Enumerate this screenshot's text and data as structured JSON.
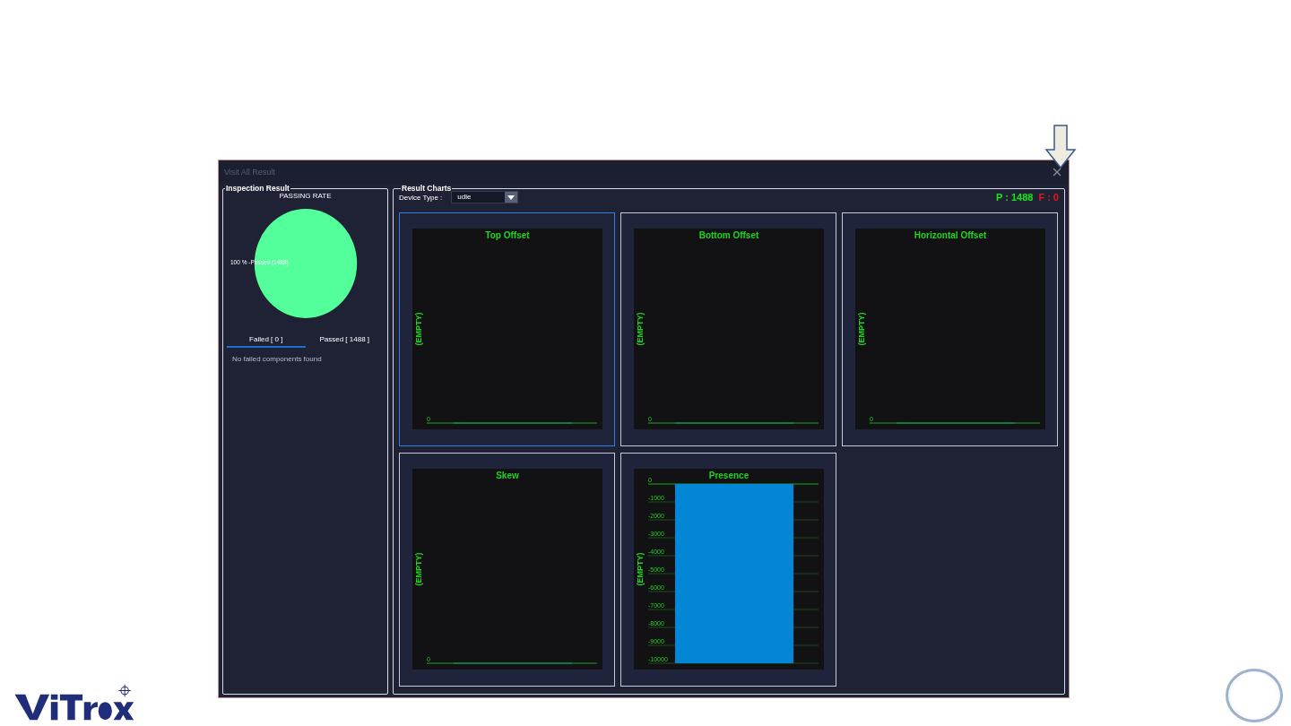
{
  "window": {
    "title": "Visit All Result"
  },
  "inspection_result": {
    "legend": "Inspection Result",
    "chart_data": {
      "type": "pie",
      "title": "PASSING RATE",
      "values": [
        1488
      ],
      "value_labels": [
        "100 % -Passed (1488)"
      ]
    },
    "tabs": [
      {
        "label": "Failed [ 0 ]",
        "selected": true
      },
      {
        "label": "Passed [ 1488 ]",
        "selected": false
      }
    ],
    "message": "No failed components found"
  },
  "result_charts": {
    "legend": "Result Charts",
    "device_type_label": "Device Type :",
    "device_type": "udie",
    "passed": "P : 1488",
    "failed": "F : 0",
    "charts": [
      {
        "kind": "empty",
        "selected": true,
        "title": "Top Offset",
        "ylabel": "(EMPTY)",
        "tick": "0"
      },
      {
        "kind": "empty",
        "selected": false,
        "title": "Bottom Offset",
        "ylabel": "(EMPTY)",
        "tick": "0"
      },
      {
        "kind": "empty",
        "selected": false,
        "title": "Horizontal Offset",
        "ylabel": "(EMPTY)",
        "tick": "0"
      },
      {
        "kind": "empty",
        "selected": false,
        "title": "Skew",
        "ylabel": "(EMPTY)",
        "tick": "0"
      },
      {
        "kind": "chart",
        "selected": false,
        "chart_data": {
          "type": "bar",
          "title": "Presence",
          "ylabel": "(EMPTY)",
          "values": [
            -10000
          ],
          "ylim": [
            -10000,
            0
          ],
          "yticks": [
            0,
            -1000,
            -2000,
            -3000,
            -4000,
            -5000,
            -6000,
            -7000,
            -8000,
            -9000,
            -10000
          ],
          "grid": true
        }
      }
    ]
  }
}
